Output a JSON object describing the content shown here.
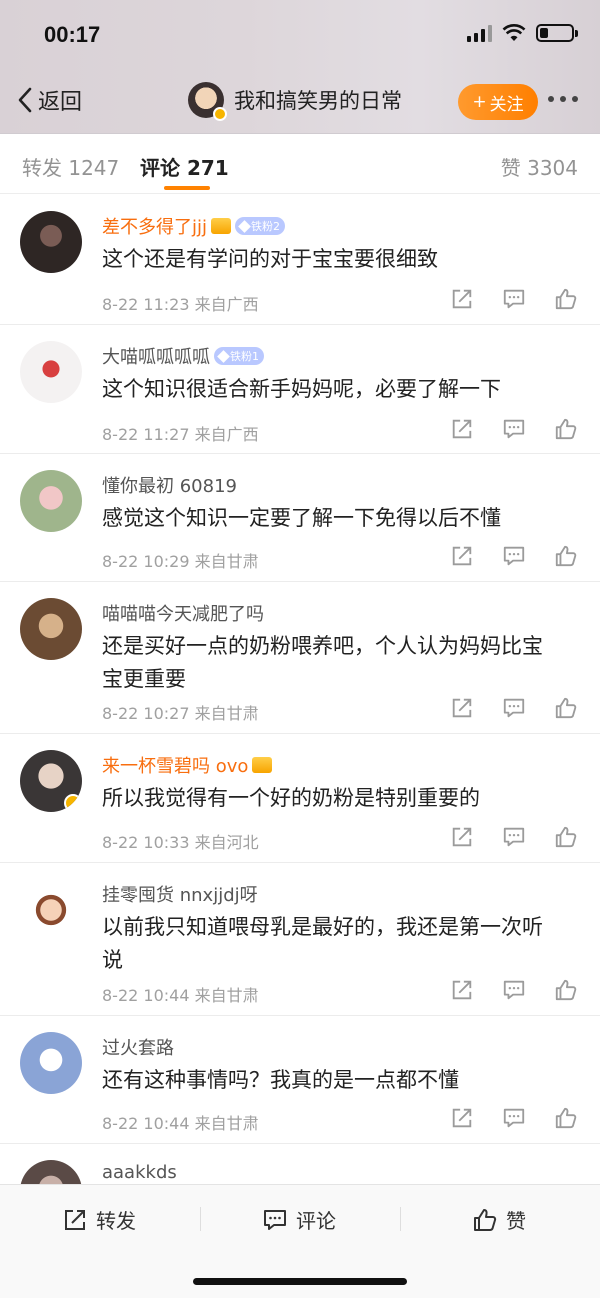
{
  "status_bar": {
    "time": "00:17",
    "battery_level": 0.25
  },
  "header": {
    "back_label": "返回",
    "title": "我和搞笑男的日常",
    "follow_label": "关注",
    "follow_prefix": "+"
  },
  "tabs": {
    "repost": {
      "label": "转发",
      "count": "1247"
    },
    "comment": {
      "label": "评论",
      "count": "271"
    },
    "like": {
      "label": "赞",
      "count": "3304"
    }
  },
  "comments": [
    {
      "name": "差不多得了jjj",
      "vip": true,
      "badge": "铁粉2",
      "crown": true,
      "text": [
        "这个还是有学问的对于宝宝要很细致"
      ],
      "time": "8-22 11:23",
      "location": "来自广西"
    },
    {
      "name": "大喵呱呱呱呱",
      "vip": false,
      "badge": "铁粉1",
      "crown": false,
      "text": [
        "这个知识很适合新手妈妈呢，必要了解一下"
      ],
      "time": "8-22 11:27",
      "location": "来自广西"
    },
    {
      "name": "懂你最初 60819",
      "vip": false,
      "badge": "",
      "crown": false,
      "text": [
        "感觉这个知识一定要了解一下免得以后不懂"
      ],
      "time": "8-22 10:29",
      "location": "来自甘肃"
    },
    {
      "name": "喵喵喵今天减肥了吗",
      "vip": false,
      "badge": "",
      "crown": false,
      "text": [
        "还是买好一点的奶粉喂养吧，个人认为妈妈比宝",
        "宝更重要"
      ],
      "time": "8-22 10:27",
      "location": "来自甘肃"
    },
    {
      "name": "来一杯雪碧吗 ovo",
      "vip": true,
      "badge": "",
      "crown": true,
      "verified": true,
      "text": [
        "所以我觉得有一个好的奶粉是特别重要的"
      ],
      "time": "8-22 10:33",
      "location": "来自河北"
    },
    {
      "name": "挂零囤货 nnxjjdj呀",
      "vip": false,
      "badge": "",
      "crown": false,
      "text": [
        "以前我只知道喂母乳是最好的，我还是第一次听",
        "说"
      ],
      "time": "8-22 10:44",
      "location": "来自甘肃"
    },
    {
      "name": "过火套路",
      "vip": false,
      "badge": "",
      "crown": false,
      "text": [
        "还有这种事情吗？我真的是一点都不懂"
      ],
      "time": "8-22 10:44",
      "location": "来自甘肃"
    },
    {
      "name": "aaakkds",
      "vip": false,
      "badge": "",
      "crown": false,
      "text": [],
      "time": "",
      "location": ""
    }
  ],
  "bottom_bar": {
    "repost": "转发",
    "comment": "评论",
    "like": "赞"
  },
  "icons": {
    "share": "share-icon",
    "reply": "comment-icon",
    "like": "thumbs-up-icon"
  },
  "colors": {
    "accent": "#ff8200",
    "vip_name": "#f86e0f"
  }
}
